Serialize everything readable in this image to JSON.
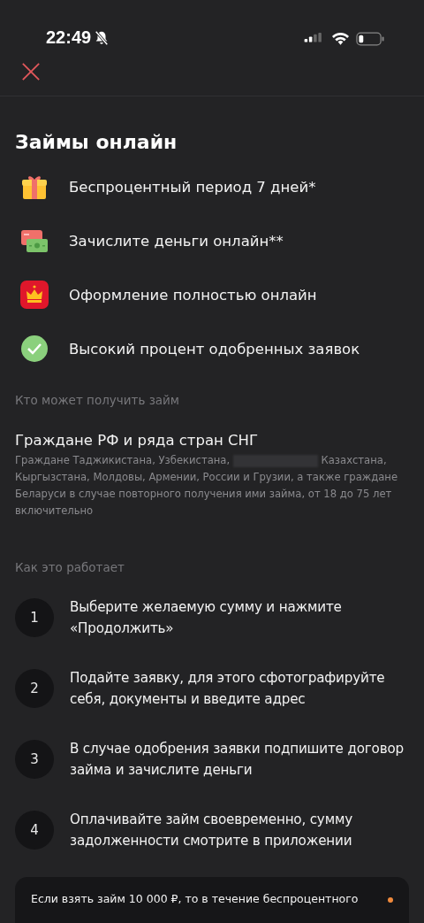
{
  "status_bar": {
    "time": "22:49"
  },
  "title": "Займы онлайн",
  "features": [
    {
      "kind": "gift",
      "text": "Беспроцентный период 7 дней*"
    },
    {
      "kind": "money",
      "text": "Зачислите деньги онлайн**"
    },
    {
      "kind": "crown",
      "text": "Оформление полностью онлайн"
    },
    {
      "kind": "check",
      "text": "Высокий процент одобренных заявок"
    }
  ],
  "eligibility": {
    "label": "Кто может получить займ",
    "heading": "Граждане РФ и ряда стран СНГ",
    "text_before": "Граждане Таджикистана, Узбекистана,",
    "text_after": "Казахстана, Кыргызстана, Молдовы, Армении, России и Грузии, а также граждане Беларуси в случае повторного получения ими займа, от 18 до 75 лет включительно"
  },
  "how_it_works": {
    "label": "Как это работает",
    "steps": [
      {
        "number": "1",
        "text": "Выберите желаемую сумму и нажмите «Продолжить»"
      },
      {
        "number": "2",
        "text": "Подайте заявку, для этого сфотографируйте себя, документы и введите адрес"
      },
      {
        "number": "3",
        "text": "В случае одобрения заявки подпишите договор займа и зачислите деньги"
      },
      {
        "number": "4",
        "text": "Оплачивайте займ своевременно, сумму задолженности смотрите в приложении"
      }
    ]
  },
  "info_card": {
    "text": "Если взять займ 10 000 ₽, то в течение беспроцентного"
  }
}
